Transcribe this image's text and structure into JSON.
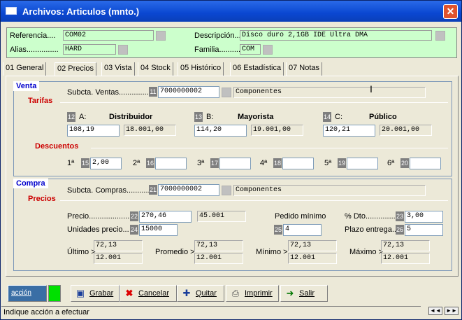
{
  "title": "Archivos: Articulos (mnto.)",
  "close": "✕",
  "header": {
    "referencia_label": "Referencia....",
    "referencia": "COM02",
    "descripcion_label": "Descripción...",
    "descripcion": "Disco duro 2,1GB IDE Ultra DMA",
    "alias_label": "Alias...............",
    "alias": "HARD",
    "familia_label": "Familia...........",
    "familia": "COM"
  },
  "tabs": [
    "01 General",
    "02 Precios",
    "03 Vista",
    "04 Stock",
    "05 Histórico",
    "06 Estadística",
    "07 Notas"
  ],
  "venta": {
    "title": "Venta",
    "tarifas": "Tarifas",
    "subcta_label": "Subcta. Ventas................",
    "subcta_num": "11",
    "subcta": "7000000002",
    "subcta_desc": "Componentes",
    "t": [
      {
        "num": "12",
        "letter": "A:",
        "name": "Distribuidor",
        "price": "108,19",
        "pvp": "18.001,00"
      },
      {
        "num": "13",
        "letter": "B:",
        "name": "Mayorista",
        "price": "114,20",
        "pvp": "19.001,00"
      },
      {
        "num": "14",
        "letter": "C:",
        "name": "Público",
        "price": "120,21",
        "pvp": "20.001,00"
      }
    ],
    "descuentos": "Descuentos",
    "d": [
      {
        "label": "1ª",
        "num": "15",
        "value": "2,00"
      },
      {
        "label": "2ª",
        "num": "16",
        "value": ""
      },
      {
        "label": "3ª",
        "num": "17",
        "value": ""
      },
      {
        "label": "4ª",
        "num": "18",
        "value": ""
      },
      {
        "label": "5ª",
        "num": "19",
        "value": ""
      },
      {
        "label": "6ª",
        "num": "20",
        "value": ""
      }
    ]
  },
  "compra": {
    "title": "Compra",
    "precios": "Precios",
    "subcta_label": "Subcta. Compras............",
    "subcta_num": "21",
    "subcta": "7000000002",
    "subcta_desc": "Componentes",
    "precio_label": "Precio...................",
    "precio_num": "22",
    "precio": "270,46",
    "precio_ro": "45.001",
    "unid_label": "Unidades precio...",
    "unid_num": "24",
    "unid": "15000",
    "pedido_label": "Pedido mínimo",
    "pedido_num": "25",
    "pedido": "4",
    "dto_label": "% Dto...............",
    "dto_num": "23",
    "dto": "3,00",
    "plazo_label": "Plazo entrega....",
    "plazo_num": "26",
    "plazo": "5",
    "ultimo_label": "Último >",
    "ultimo_a": "72,13",
    "ultimo_b": "12.001",
    "promedio_label": "Promedio >",
    "promedio_a": "72,13",
    "promedio_b": "12.001",
    "minimo_label": "Mínimo >",
    "minimo_a": "72,13",
    "minimo_b": "12.001",
    "maximo_label": "Máximo >",
    "maximo_a": "72,13",
    "maximo_b": "12.001"
  },
  "toolbar": {
    "accion": "acción",
    "grabar": "Grabar",
    "cancelar": "Cancelar",
    "quitar": "Quitar",
    "imprimir": "Imprimir",
    "salir": "Salir"
  },
  "status": "Indique acción a efectuar",
  "nav": {
    "first": "◄◄",
    "next": "►►"
  }
}
